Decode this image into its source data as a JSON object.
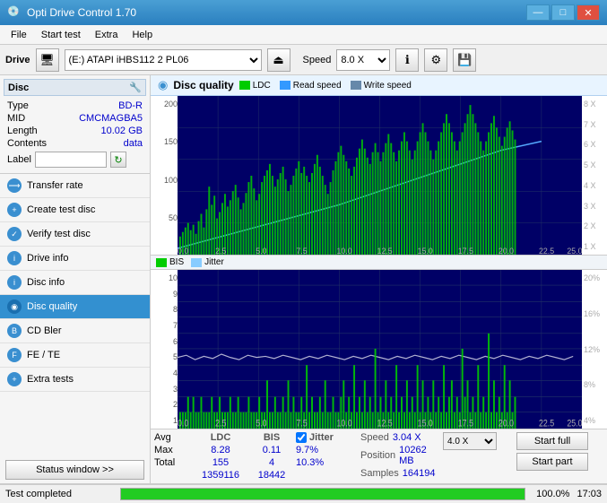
{
  "app": {
    "title": "Opti Drive Control 1.70",
    "icon": "💿"
  },
  "titlebar": {
    "minimize": "—",
    "maximize": "□",
    "close": "✕"
  },
  "menu": {
    "items": [
      "File",
      "Start test",
      "Extra",
      "Help"
    ]
  },
  "toolbar": {
    "drive_label": "Drive",
    "drive_value": "(E:) ATAPI iHBS112  2 PL06",
    "speed_label": "Speed",
    "speed_value": "8.0 X"
  },
  "disc": {
    "header": "Disc",
    "type_label": "Type",
    "type_value": "BD-R",
    "mid_label": "MID",
    "mid_value": "CMCMAGBA5",
    "length_label": "Length",
    "length_value": "10.02 GB",
    "contents_label": "Contents",
    "contents_value": "data",
    "label_label": "Label"
  },
  "nav": {
    "items": [
      {
        "id": "transfer-rate",
        "label": "Transfer rate",
        "active": false
      },
      {
        "id": "create-test-disc",
        "label": "Create test disc",
        "active": false
      },
      {
        "id": "verify-test-disc",
        "label": "Verify test disc",
        "active": false
      },
      {
        "id": "drive-info",
        "label": "Drive info",
        "active": false
      },
      {
        "id": "disc-info",
        "label": "Disc info",
        "active": false
      },
      {
        "id": "disc-quality",
        "label": "Disc quality",
        "active": true
      },
      {
        "id": "cd-bler",
        "label": "CD Bler",
        "active": false
      },
      {
        "id": "fe-te",
        "label": "FE / TE",
        "active": false
      },
      {
        "id": "extra-tests",
        "label": "Extra tests",
        "active": false
      }
    ]
  },
  "status_window_btn": "Status window >>",
  "disc_quality": {
    "title": "Disc quality",
    "legend": [
      {
        "label": "LDC",
        "color": "#00cc00"
      },
      {
        "label": "Read speed",
        "color": "#00aaff"
      },
      {
        "label": "Write speed",
        "color": "#88aacc"
      }
    ],
    "legend2": [
      {
        "label": "BIS",
        "color": "#00cc00"
      },
      {
        "label": "Jitter",
        "color": "#88ccff"
      }
    ],
    "chart1": {
      "y_max": 200,
      "y_labels": [
        "200",
        "150",
        "100",
        "50"
      ],
      "x_max": 25.0,
      "right_labels": [
        "8X",
        "7X",
        "6X",
        "5X",
        "4X",
        "3X",
        "2X",
        "1X"
      ]
    },
    "chart2": {
      "y_max": 10,
      "y_labels": [
        "10",
        "9",
        "8",
        "7",
        "6",
        "5",
        "4",
        "3",
        "2",
        "1"
      ],
      "x_max": 25.0,
      "right_labels": [
        "20%",
        "16%",
        "12%",
        "8%",
        "4%"
      ]
    }
  },
  "stats": {
    "headers": [
      "",
      "LDC",
      "BIS",
      "",
      "Jitter",
      "Speed",
      ""
    ],
    "avg_label": "Avg",
    "max_label": "Max",
    "total_label": "Total",
    "ldc_avg": "8.28",
    "ldc_max": "155",
    "ldc_total": "1359116",
    "bis_avg": "0.11",
    "bis_max": "4",
    "bis_total": "18442",
    "jitter_avg": "9.7%",
    "jitter_max": "10.3%",
    "jitter_check": true,
    "speed_avg": "3.04 X",
    "speed_dropdown": "4.0 X",
    "position_label": "Position",
    "samples_label": "Samples",
    "position_value": "10262 MB",
    "samples_value": "164194",
    "start_full": "Start full",
    "start_part": "Start part"
  },
  "statusbar": {
    "text": "Test completed",
    "progress": 100.0,
    "progress_text": "100.0%",
    "time": "17:03"
  }
}
